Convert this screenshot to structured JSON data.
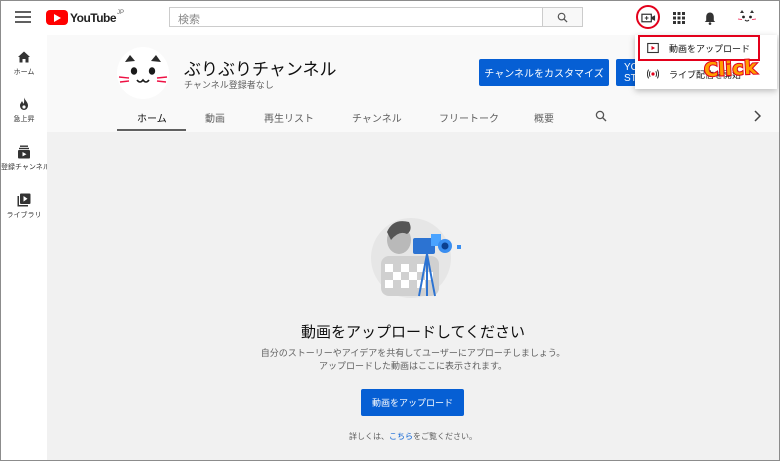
{
  "header": {
    "logo_text": "YouTube",
    "logo_region": "JP",
    "search_placeholder": "検索"
  },
  "sidebar": {
    "items": [
      {
        "label": "ホーム",
        "icon": "home-icon"
      },
      {
        "label": "急上昇",
        "icon": "flame-icon"
      },
      {
        "label": "登録チャンネル",
        "icon": "subscriptions-icon"
      },
      {
        "label": "ライブラリ",
        "icon": "library-icon"
      }
    ]
  },
  "channel": {
    "name": "ぶりぶりチャンネル",
    "subscribers": "チャンネル登録者なし",
    "customize_label": "チャンネルをカスタマイズ",
    "studio_label": "YOUTUBE STUDIO"
  },
  "tabs": [
    "ホーム",
    "動画",
    "再生リスト",
    "チャンネル",
    "フリートーク",
    "概要"
  ],
  "active_tab": "ホーム",
  "main": {
    "empty_title": "動画をアップロードしてください",
    "empty_desc_line1": "自分のストーリーやアイデアを共有してユーザーにアプローチしましょう。",
    "empty_desc_line2": "アップロードした動画はここに表示されます。",
    "upload_button": "動画をアップロード",
    "help_prefix": "詳しくは、",
    "help_link": "こちら",
    "help_suffix": "をご覧ください。"
  },
  "create_menu": {
    "items": [
      {
        "label": "動画をアップロード",
        "icon": "upload-video-icon"
      },
      {
        "label": "ライブ配信を開始",
        "icon": "live-icon"
      }
    ]
  },
  "annotation": {
    "click_text": "Click",
    "highlight_color": "#e3001b",
    "text_color": "#ff9d00"
  },
  "colors": {
    "brand_red": "#ff0000",
    "accent_blue": "#065fd4"
  }
}
